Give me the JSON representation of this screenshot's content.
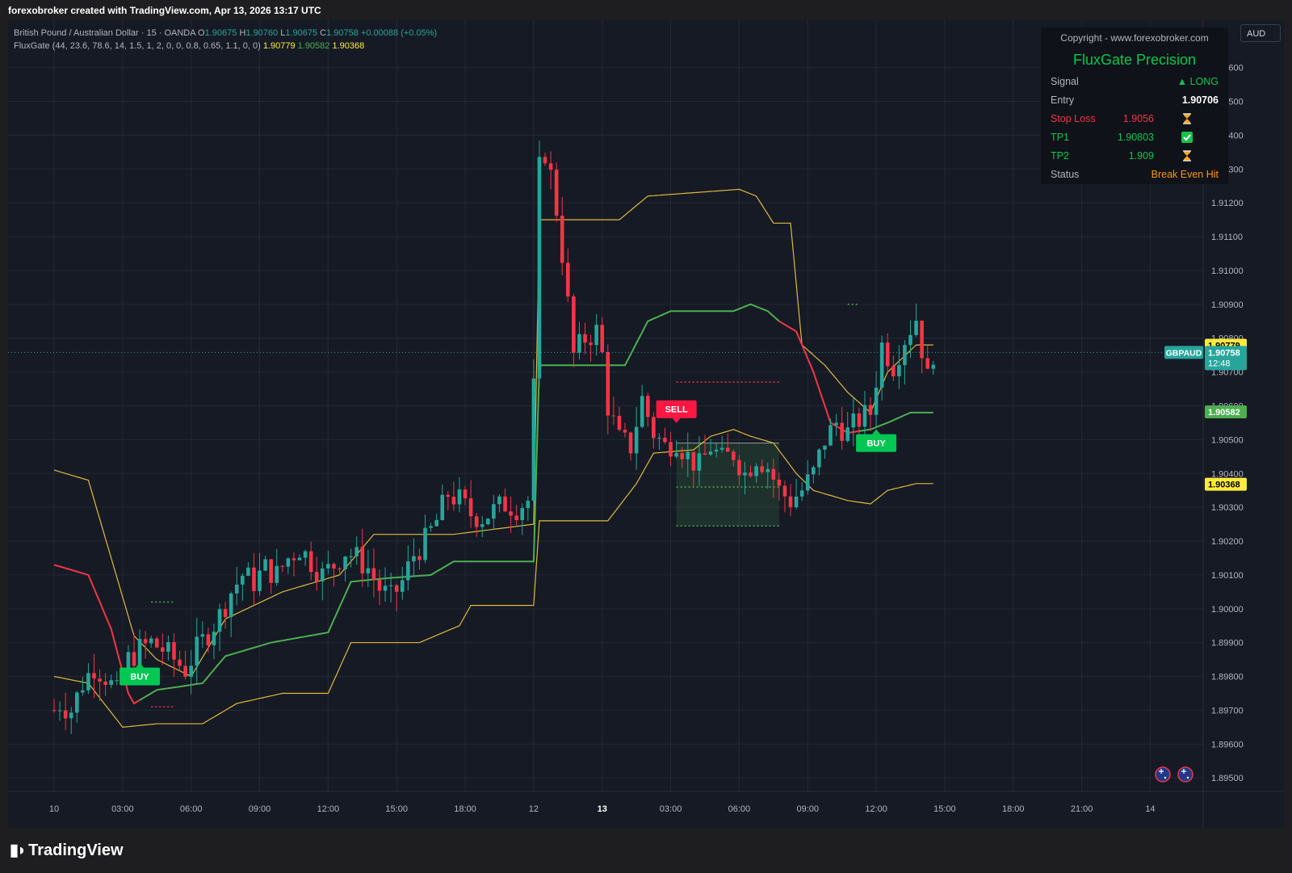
{
  "header": {
    "title": "forexobroker created with TradingView.com, Apr 13, 2026 13:17 UTC"
  },
  "legend": {
    "symbol_line": "British Pound / Australian Dollar · 15 · OANDA",
    "o_label": "O",
    "o_value": "1.90675",
    "h_label": "H",
    "h_value": "1.90760",
    "l_label": "L",
    "l_value": "1.90675",
    "c_label": "C",
    "c_value": "1.90758",
    "change": "+0.00088 (+0.05%)",
    "indicator": "FluxGate (44, 23.6, 78.6, 14, 1.5, 1, 2, 0, 0, 0.8, 0.65, 1.1, 0, 0)",
    "ind_v1": "1.90779",
    "ind_v2": "1.90582",
    "ind_v3": "1.90368"
  },
  "panel": {
    "copyright": "Copyright - www.forexobroker.com",
    "title": "FluxGate Precision",
    "rows": [
      {
        "label": "Signal",
        "mid": "",
        "value": "▲ LONG",
        "icon": ""
      },
      {
        "label": "Entry",
        "mid": "",
        "value": "1.90706",
        "icon": ""
      },
      {
        "label": "Stop Loss",
        "mid": "1.9056",
        "value": "",
        "icon": "hourglass-icon"
      },
      {
        "label": "TP1",
        "mid": "1.90803",
        "value": "",
        "icon": "check-icon"
      },
      {
        "label": "TP2",
        "mid": "1.909",
        "value": "",
        "icon": "hourglass-icon"
      },
      {
        "label": "Status",
        "mid": "",
        "value": "Break Even Hit",
        "icon": ""
      }
    ]
  },
  "currency": "AUD",
  "footer": {
    "brand": "TradingView"
  },
  "colors": {
    "up": "#26a69a",
    "down": "#f23645",
    "upper_band": "#e0b93a",
    "mid_green": "#4caf50",
    "mid_red": "#f23645",
    "buy": "#00c853",
    "sell": "#ff1744",
    "background": "#161a25"
  },
  "chart_data": {
    "type": "candlestick",
    "symbol": "GBPAUD",
    "timeframe": "15",
    "ylim": [
      1.8946,
      1.9174
    ],
    "y_ticks": [
      "1.89500",
      "1.89600",
      "1.89700",
      "1.89800",
      "1.89900",
      "1.90000",
      "1.90100",
      "1.90200",
      "1.90300",
      "1.90400",
      "1.90500",
      "1.90600",
      "1.90700",
      "1.90800",
      "1.90900",
      "1.91000",
      "1.91100",
      "1.91200",
      "1.91300",
      "1.91400",
      "1.91500",
      "1.91600"
    ],
    "x_ticks": [
      {
        "label": "10",
        "t": 0,
        "bold": false
      },
      {
        "label": "03:00",
        "t": 12,
        "bold": false
      },
      {
        "label": "06:00",
        "t": 24,
        "bold": false
      },
      {
        "label": "09:00",
        "t": 36,
        "bold": false
      },
      {
        "label": "12:00",
        "t": 48,
        "bold": false
      },
      {
        "label": "15:00",
        "t": 60,
        "bold": false
      },
      {
        "label": "18:00",
        "t": 72,
        "bold": false
      },
      {
        "label": "12",
        "t": 84,
        "bold": false
      },
      {
        "label": "13",
        "t": 96,
        "bold": true
      },
      {
        "label": "03:00",
        "t": 108,
        "bold": false
      },
      {
        "label": "06:00",
        "t": 120,
        "bold": false
      },
      {
        "label": "09:00",
        "t": 132,
        "bold": false
      },
      {
        "label": "12:00",
        "t": 144,
        "bold": false
      },
      {
        "label": "15:00",
        "t": 156,
        "bold": false
      },
      {
        "label": "18:00",
        "t": 168,
        "bold": false
      },
      {
        "label": "21:00",
        "t": 180,
        "bold": false
      },
      {
        "label": "14",
        "t": 192,
        "bold": false
      }
    ],
    "candle_anchors": [
      [
        0,
        1.897
      ],
      [
        1,
        1.8972
      ],
      [
        3,
        1.897
      ],
      [
        5,
        1.8978
      ],
      [
        7,
        1.8983
      ],
      [
        9,
        1.898
      ],
      [
        11,
        1.8975
      ],
      [
        13,
        1.8985
      ],
      [
        15,
        1.8988
      ],
      [
        17,
        1.899
      ],
      [
        19,
        1.8988
      ],
      [
        21,
        1.8985
      ],
      [
        23,
        1.8982
      ],
      [
        25,
        1.8988
      ],
      [
        27,
        1.8993
      ],
      [
        29,
        1.8998
      ],
      [
        31,
        1.9005
      ],
      [
        33,
        1.901
      ],
      [
        35,
        1.9008
      ],
      [
        37,
        1.9012
      ],
      [
        39,
        1.901
      ],
      [
        41,
        1.9015
      ],
      [
        43,
        1.9018
      ],
      [
        45,
        1.9014
      ],
      [
        47,
        1.901
      ],
      [
        49,
        1.9013
      ],
      [
        51,
        1.9017
      ],
      [
        53,
        1.9015
      ],
      [
        55,
        1.9012
      ],
      [
        57,
        1.9006
      ],
      [
        59,
        1.9003
      ],
      [
        61,
        1.9008
      ],
      [
        63,
        1.9016
      ],
      [
        65,
        1.902
      ],
      [
        67,
        1.9026
      ],
      [
        69,
        1.9034
      ],
      [
        71,
        1.9032
      ],
      [
        73,
        1.9028
      ],
      [
        75,
        1.9027
      ],
      [
        77,
        1.9029
      ],
      [
        79,
        1.9031
      ],
      [
        81,
        1.903
      ],
      [
        83,
        1.9032
      ],
      [
        84,
        1.9065
      ],
      [
        85,
        1.913
      ],
      [
        86,
        1.9135
      ],
      [
        87,
        1.9128
      ],
      [
        88,
        1.9118
      ],
      [
        89,
        1.9105
      ],
      [
        90,
        1.909
      ],
      [
        91,
        1.9075
      ],
      [
        93,
        1.908
      ],
      [
        95,
        1.9082
      ],
      [
        96,
        1.9075
      ],
      [
        97,
        1.906
      ],
      [
        99,
        1.905
      ],
      [
        101,
        1.9048
      ],
      [
        103,
        1.9062
      ],
      [
        105,
        1.9052
      ],
      [
        107,
        1.9048
      ],
      [
        109,
        1.905
      ],
      [
        111,
        1.9045
      ],
      [
        113,
        1.9042
      ],
      [
        115,
        1.9048
      ],
      [
        117,
        1.9044
      ],
      [
        119,
        1.9046
      ],
      [
        121,
        1.904
      ],
      [
        123,
        1.9045
      ],
      [
        125,
        1.9042
      ],
      [
        127,
        1.9035
      ],
      [
        129,
        1.9032
      ],
      [
        131,
        1.9035
      ],
      [
        133,
        1.904
      ],
      [
        135,
        1.905
      ],
      [
        137,
        1.9055
      ],
      [
        139,
        1.9052
      ],
      [
        141,
        1.9056
      ],
      [
        143,
        1.9058
      ],
      [
        145,
        1.9078
      ],
      [
        147,
        1.9072
      ],
      [
        149,
        1.908
      ],
      [
        151,
        1.9086
      ],
      [
        153,
        1.9068
      ],
      [
        154,
        1.9076
      ]
    ],
    "bands": {
      "upper": [
        [
          0,
          1.9041
        ],
        [
          6,
          1.9038
        ],
        [
          10,
          1.9015
        ],
        [
          14,
          1.8992
        ],
        [
          18,
          1.8985
        ],
        [
          24,
          1.898
        ],
        [
          30,
          1.8997
        ],
        [
          40,
          1.9005
        ],
        [
          50,
          1.901
        ],
        [
          56,
          1.9022
        ],
        [
          70,
          1.9022
        ],
        [
          84,
          1.9025
        ],
        [
          85,
          1.9115
        ],
        [
          99,
          1.9115
        ],
        [
          104,
          1.9122
        ],
        [
          120,
          1.9124
        ],
        [
          123,
          1.9122
        ],
        [
          126,
          1.9114
        ],
        [
          129,
          1.9114
        ],
        [
          131,
          1.9078
        ],
        [
          135,
          1.9072
        ],
        [
          139,
          1.9064
        ],
        [
          143,
          1.9058
        ],
        [
          146,
          1.907
        ],
        [
          151,
          1.9078
        ],
        [
          154,
          1.9078
        ]
      ],
      "mid": [
        [
          0,
          1.9013
        ],
        [
          6,
          1.901
        ],
        [
          10,
          1.8994
        ],
        [
          13,
          1.8975
        ],
        [
          14,
          1.8972
        ],
        [
          18,
          1.8976
        ],
        [
          26,
          1.8978
        ],
        [
          30,
          1.8986
        ],
        [
          38,
          1.899
        ],
        [
          48,
          1.8993
        ],
        [
          52,
          1.9008
        ],
        [
          58,
          1.9009
        ],
        [
          66,
          1.901
        ],
        [
          70,
          1.9014
        ],
        [
          84,
          1.9014
        ],
        [
          85,
          1.9072
        ],
        [
          100,
          1.9072
        ],
        [
          104,
          1.9085
        ],
        [
          108,
          1.9088
        ],
        [
          119,
          1.9088
        ],
        [
          122,
          1.909
        ],
        [
          125,
          1.9088
        ],
        [
          127,
          1.9085
        ],
        [
          130,
          1.9082
        ],
        [
          133,
          1.907
        ],
        [
          136,
          1.9055
        ],
        [
          139,
          1.9052
        ],
        [
          143,
          1.9053
        ],
        [
          146,
          1.9055
        ],
        [
          150,
          1.9058
        ],
        [
          154,
          1.9058
        ]
      ],
      "lower": [
        [
          0,
          1.898
        ],
        [
          6,
          1.8978
        ],
        [
          12,
          1.8965
        ],
        [
          18,
          1.8966
        ],
        [
          26,
          1.8966
        ],
        [
          32,
          1.8972
        ],
        [
          40,
          1.8975
        ],
        [
          48,
          1.8975
        ],
        [
          52,
          1.899
        ],
        [
          64,
          1.899
        ],
        [
          71,
          1.8995
        ],
        [
          73,
          1.9001
        ],
        [
          84,
          1.9001
        ],
        [
          85,
          1.9026
        ],
        [
          97,
          1.9026
        ],
        [
          102,
          1.9037
        ],
        [
          105,
          1.9046
        ],
        [
          112,
          1.9047
        ],
        [
          115,
          1.9051
        ],
        [
          119,
          1.9053
        ],
        [
          122,
          1.9051
        ],
        [
          126,
          1.9049
        ],
        [
          130,
          1.904
        ],
        [
          133,
          1.9035
        ],
        [
          139,
          1.9032
        ],
        [
          143,
          1.9031
        ],
        [
          146,
          1.9035
        ],
        [
          151,
          1.9037
        ],
        [
          154,
          1.9037
        ]
      ],
      "mid_red_until": 15,
      "mid_red_from": 127,
      "mid_red_to": 141
    },
    "signals": [
      {
        "label": "BUY",
        "t": 15,
        "price": 1.898,
        "kind": "buy"
      },
      {
        "label": "SELL",
        "t": 109,
        "price": 1.9059,
        "kind": "sell"
      },
      {
        "label": "BUY",
        "t": 144,
        "price": 1.9049,
        "kind": "buy"
      }
    ],
    "levels": [
      {
        "t1": 17,
        "t2": 21,
        "price": 1.9002,
        "color": "#4caf50"
      },
      {
        "t1": 17,
        "t2": 21,
        "price": 1.8971,
        "color": "#f23645"
      },
      {
        "t1": 109,
        "t2": 127,
        "price": 1.9067,
        "color": "#f23645"
      },
      {
        "t1": 109,
        "t2": 127,
        "price": 1.9036,
        "color": "#4caf50"
      },
      {
        "t1": 109,
        "t2": 127,
        "price": 1.90245,
        "color": "#4caf50"
      },
      {
        "t1": 139,
        "t2": 141,
        "price": 1.909,
        "color": "#4caf50"
      }
    ],
    "zone": {
      "t1": 109,
      "t2": 127,
      "top": 1.9049,
      "bottom": 1.90245
    },
    "price_labels": [
      {
        "text": "1.90779",
        "price": 1.90779,
        "bg": "#ffeb3b",
        "fg": "#000000"
      },
      {
        "text": "1.90758",
        "sub": "12:48",
        "price": 1.90758,
        "bg": "#26a69a",
        "fg": "#ffffff",
        "tag": "GBPAUD"
      },
      {
        "text": "1.90582",
        "price": 1.90582,
        "bg": "#4caf50",
        "fg": "#ffffff"
      },
      {
        "text": "1.90368",
        "price": 1.90368,
        "bg": "#ffeb3b",
        "fg": "#000000"
      }
    ],
    "current_price": 1.90758
  }
}
